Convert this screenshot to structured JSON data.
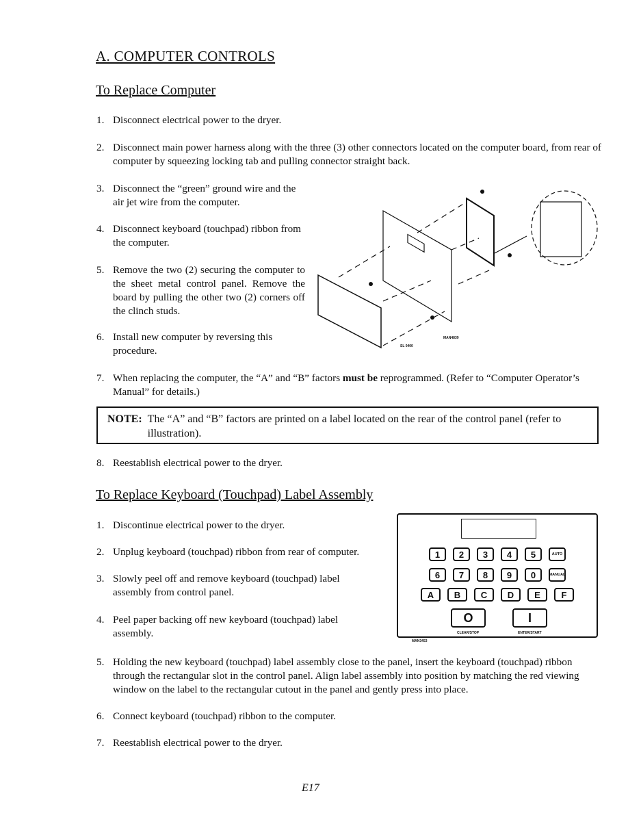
{
  "section_title": "A.  COMPUTER CONTROLS",
  "replace_computer": {
    "heading": "To Replace Computer",
    "steps": [
      {
        "num": "1.",
        "text": "Disconnect electrical power to the dryer."
      },
      {
        "num": "2.",
        "text": "Disconnect main power harness along with the three (3) other connectors located on the computer board, from rear of computer by squeezing locking tab and pulling connector straight back."
      },
      {
        "num": "3.",
        "text": "Disconnect the “green” ground wire and the air jet wire from the computer."
      },
      {
        "num": "4.",
        "text": "Disconnect keyboard (touchpad) ribbon from the computer."
      },
      {
        "num": "5.",
        "text": "Remove the two (2) securing the computer to the sheet metal control panel. Remove the board by pulling the other two (2) corners off the clinch studs."
      },
      {
        "num": "6.",
        "text": "Install new computer by reversing this procedure."
      },
      {
        "num": "7.",
        "text_before": "When replacing the computer, the “A” and “B” factors ",
        "text_bold": "must be",
        "text_after": " reprogrammed. (Refer to “Computer Operator’s Manual” for details.)"
      },
      {
        "num": "8.",
        "text": "Reestablish electrical power to the dryer."
      }
    ],
    "figure_label": "MAN4839",
    "figure_sublabel": "SL 0400"
  },
  "note": {
    "label": "NOTE:",
    "text": "The “A” and “B” factors are printed on a label located on the rear of the control panel (refer to illustration)."
  },
  "replace_keyboard": {
    "heading": "To Replace Keyboard (Touchpad) Label Assembly",
    "steps": [
      {
        "num": "1.",
        "text": "Discontinue electrical power to the dryer."
      },
      {
        "num": "2.",
        "text": "Unplug keyboard (touchpad) ribbon from rear of computer."
      },
      {
        "num": "3.",
        "text": "Slowly peel off and remove keyboard (touchpad) label assembly from control panel."
      },
      {
        "num": "4.",
        "text": "Peel paper backing off new keyboard (touchpad) label assembly."
      },
      {
        "num": "5.",
        "text": "Holding the new keyboard (touchpad) label assembly close to the panel, insert the keyboard (touchpad) ribbon through the rectangular slot in the control panel. Align label assembly into position by matching the red viewing window on the label to the rectangular cutout in the panel and gently press into place."
      },
      {
        "num": "6.",
        "text": "Connect keyboard (touchpad) ribbon to the computer."
      },
      {
        "num": "7.",
        "text": "Reestablish electrical power to the dryer."
      }
    ],
    "keypad": {
      "row1": [
        "1",
        "2",
        "3",
        "4",
        "5",
        "AUTO"
      ],
      "row2": [
        "6",
        "7",
        "8",
        "9",
        "0",
        "MANUAL"
      ],
      "row3": [
        "A",
        "B",
        "C",
        "D",
        "E",
        "F"
      ],
      "clear_symbol": "O",
      "enter_symbol": "I",
      "clear_label": "CLEAR/STOP",
      "enter_label": "ENTER/START"
    },
    "figure_label": "MAN3453"
  },
  "page_number": "E17"
}
